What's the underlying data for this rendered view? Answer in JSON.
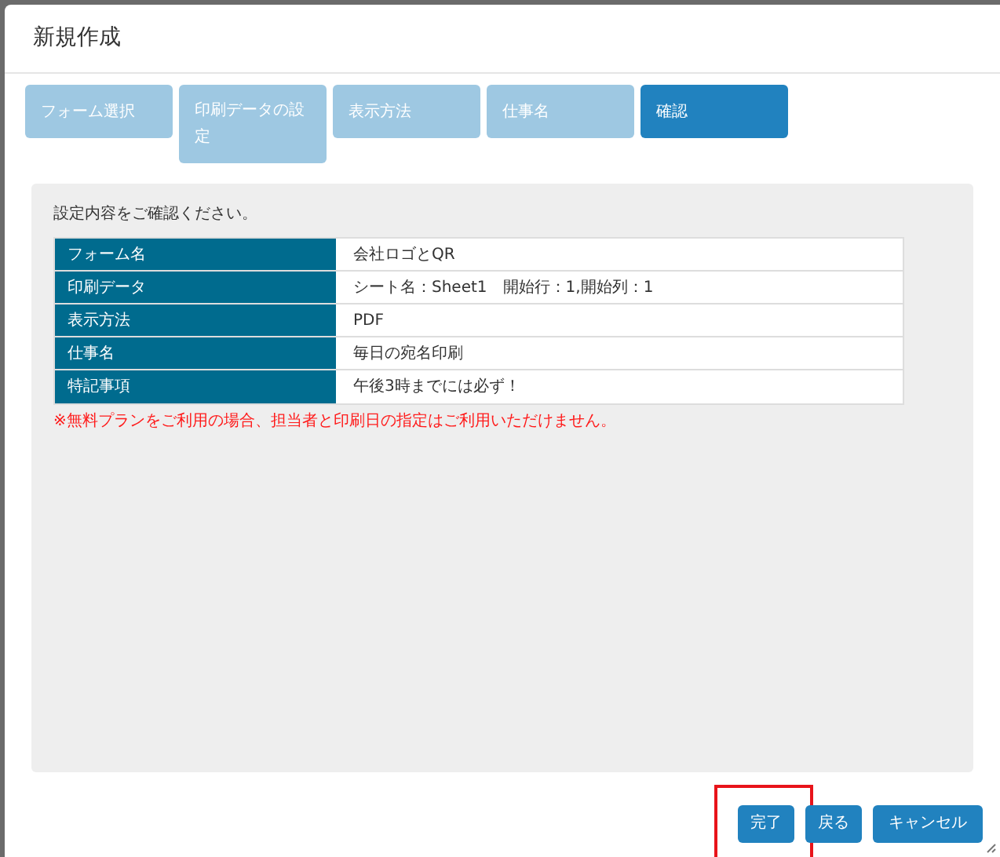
{
  "dialog": {
    "title": "新規作成"
  },
  "steps": [
    {
      "label": "フォーム選択",
      "selected": false
    },
    {
      "label": "印刷データの設定",
      "selected": false
    },
    {
      "label": "表示方法",
      "selected": false
    },
    {
      "label": "仕事名",
      "selected": false
    },
    {
      "label": "確認",
      "selected": true
    }
  ],
  "panel": {
    "instruction": "設定内容をご確認ください。",
    "rows": [
      {
        "label": "フォーム名",
        "value": "会社ロゴとQR"
      },
      {
        "label": "印刷データ",
        "value": "シート名：Sheet1　開始行：1,開始列：1"
      },
      {
        "label": "表示方法",
        "value": "PDF"
      },
      {
        "label": "仕事名",
        "value": "毎日の宛名印刷"
      },
      {
        "label": "特記事項",
        "value": "午後3時までには必ず！"
      }
    ],
    "warning": "※無料プランをご利用の場合、担当者と印刷日の指定はご利用いただけません。"
  },
  "buttons": [
    {
      "label": "完了",
      "highlighted": true
    },
    {
      "label": "戻る",
      "highlighted": false
    },
    {
      "label": "キャンセル",
      "highlighted": false
    }
  ]
}
